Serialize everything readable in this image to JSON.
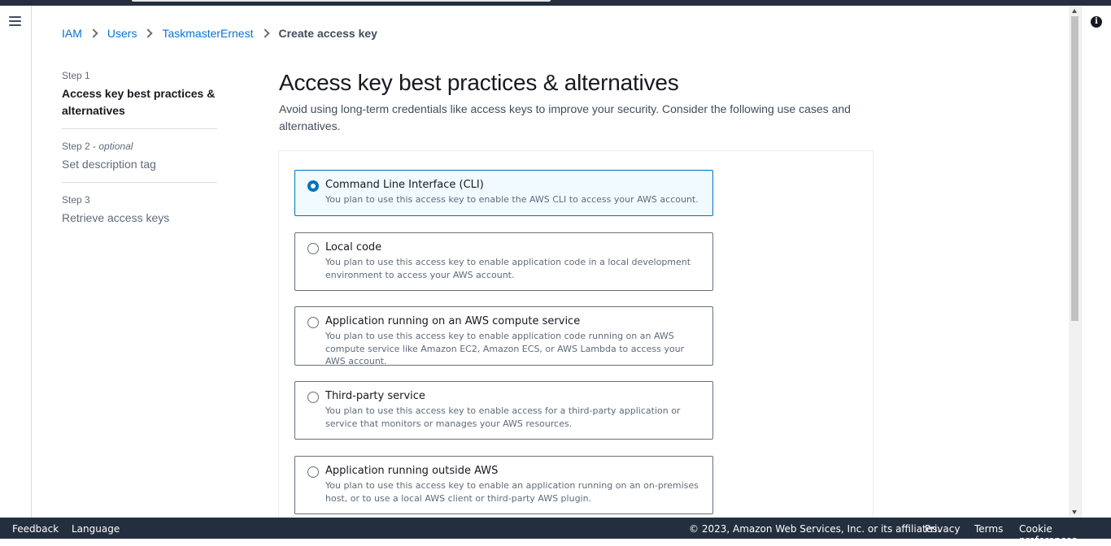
{
  "breadcrumb": {
    "items": [
      "IAM",
      "Users",
      "TaskmasterErnest"
    ],
    "current": "Create access key"
  },
  "steps": [
    {
      "number": "Step 1",
      "optional": "",
      "title": "Access key best practices & alternatives",
      "active": true
    },
    {
      "number": "Step 2",
      "optional": "optional",
      "title": "Set description tag",
      "active": false
    },
    {
      "number": "Step 3",
      "optional": "",
      "title": "Retrieve access keys",
      "active": false
    }
  ],
  "main": {
    "title": "Access key best practices & alternatives",
    "description": "Avoid using long-term credentials like access keys to improve your security. Consider the following use cases and alternatives."
  },
  "options": [
    {
      "label": "Command Line Interface (CLI)",
      "description": "You plan to use this access key to enable the AWS CLI to access your AWS account.",
      "selected": true
    },
    {
      "label": "Local code",
      "description": "You plan to use this access key to enable application code in a local development environment to access your AWS account.",
      "selected": false
    },
    {
      "label": "Application running on an AWS compute service",
      "description": "You plan to use this access key to enable application code running on an AWS compute service like Amazon EC2, Amazon ECS, or AWS Lambda to access your AWS account.",
      "selected": false
    },
    {
      "label": "Third-party service",
      "description": "You plan to use this access key to enable access for a third-party application or service that monitors or manages your AWS resources.",
      "selected": false
    },
    {
      "label": "Application running outside AWS",
      "description": "You plan to use this access key to enable an application running on an on-premises host, or to use a local AWS client or third-party AWS plugin.",
      "selected": false
    }
  ],
  "footer": {
    "feedback": "Feedback",
    "language": "Language",
    "copyright": "© 2023, Amazon Web Services, Inc. or its affiliates.",
    "privacy": "Privacy",
    "terms": "Terms",
    "cookie": "Cookie preferences"
  },
  "icons": {
    "menu": "menu-icon",
    "info": "info-icon",
    "separator": "chevron-right-icon"
  },
  "colors": {
    "link": "#0972d3",
    "selected_border": "#0073bb",
    "selected_bg": "#f1faff",
    "header_bg": "#232f3e"
  }
}
